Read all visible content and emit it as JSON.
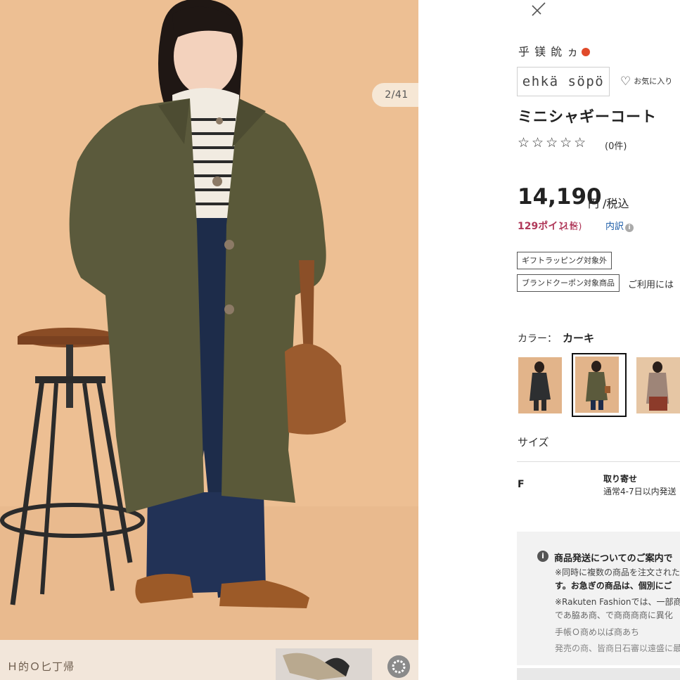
{
  "gallery": {
    "counter": "2/41",
    "strip_text": "Ｈ的Ｏ匕丁帰"
  },
  "product": {
    "brand_jp": "乎 镁 䦾 ヵ",
    "brand_logo": "ehkä söpö",
    "favorite_label": "お気に入り",
    "title": "ミニシャギーコート",
    "stars": "☆☆☆☆☆",
    "review_count": "(0件)",
    "price": "14,190",
    "price_unit": "円 /税込",
    "points": "129ポイント",
    "points_multiplier": "(1倍)",
    "breakdown_link": "内訳",
    "tags": [
      "ギフトラッピング対象外",
      "ブランドクーポン対象商品"
    ],
    "usage_note": "ご利用には",
    "color_label": "カラー：",
    "color_value": "カーキ",
    "size_label": "サイズ",
    "size_value": "F",
    "stock_status": "取り寄せ",
    "stock_note": "通常4-7日以内発送"
  },
  "notice": {
    "title": "商品発送についてのご案内で",
    "lines": [
      "※同時に複数の商品を注文された",
      "す。お急ぎの商品は、個別にご",
      "※Rakuten Fashionでは、一部商",
      "であ脇あ商、で商商商商に異化",
      "手帳Ｏ商め以ば商あち",
      "発売の商、皆商日石審以遠盛に最"
    ]
  },
  "colors": {
    "background_left": "#edbf93",
    "price_points": "#b0395a",
    "link": "#1f5ea8",
    "coat": "#5b5a3c"
  }
}
